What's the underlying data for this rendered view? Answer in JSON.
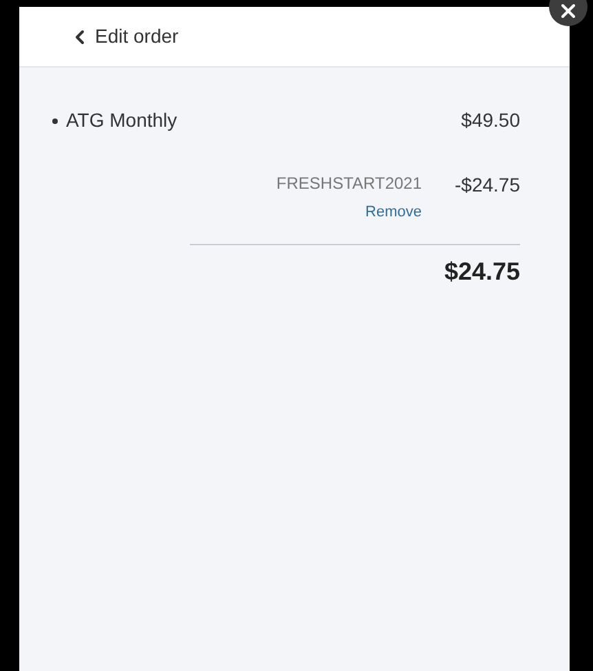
{
  "header": {
    "back_label": "Edit order"
  },
  "items": [
    {
      "name": "ATG Monthly",
      "price": "$49.50"
    }
  ],
  "discount": {
    "code": "FRESHSTART2021",
    "amount": "-$24.75",
    "remove_label": "Remove"
  },
  "total": "$24.75"
}
